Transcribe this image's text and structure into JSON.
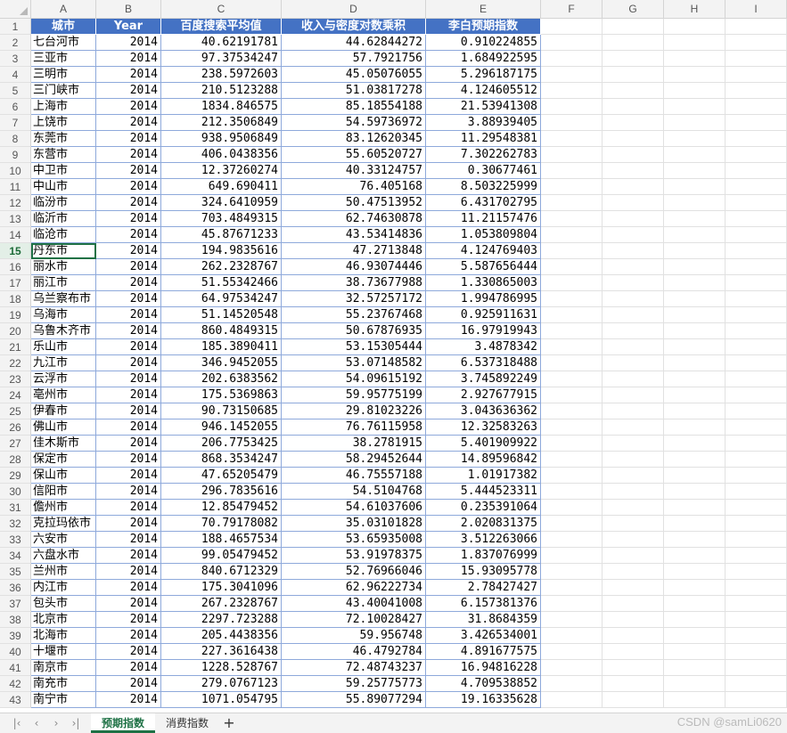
{
  "columns": [
    "A",
    "B",
    "C",
    "D",
    "E",
    "F",
    "G",
    "H",
    "I"
  ],
  "headers": [
    "城市",
    "Year",
    "百度搜索平均值",
    "收入与密度对数乘积",
    "李白预期指数"
  ],
  "rows": [
    [
      "七台河市",
      "2014",
      "40.62191781",
      "44.62844272",
      "0.910224855"
    ],
    [
      "三亚市",
      "2014",
      "97.37534247",
      "57.7921756",
      "1.684922595"
    ],
    [
      "三明市",
      "2014",
      "238.5972603",
      "45.05076055",
      "5.296187175"
    ],
    [
      "三门峡市",
      "2014",
      "210.5123288",
      "51.03817278",
      "4.124605512"
    ],
    [
      "上海市",
      "2014",
      "1834.846575",
      "85.18554188",
      "21.53941308"
    ],
    [
      "上饶市",
      "2014",
      "212.3506849",
      "54.59736972",
      "3.88939405"
    ],
    [
      "东莞市",
      "2014",
      "938.9506849",
      "83.12620345",
      "11.29548381"
    ],
    [
      "东营市",
      "2014",
      "406.0438356",
      "55.60520727",
      "7.302262783"
    ],
    [
      "中卫市",
      "2014",
      "12.37260274",
      "40.33124757",
      "0.30677461"
    ],
    [
      "中山市",
      "2014",
      "649.690411",
      "76.405168",
      "8.503225999"
    ],
    [
      "临汾市",
      "2014",
      "324.6410959",
      "50.47513952",
      "6.431702795"
    ],
    [
      "临沂市",
      "2014",
      "703.4849315",
      "62.74630878",
      "11.21157476"
    ],
    [
      "临沧市",
      "2014",
      "45.87671233",
      "43.53414836",
      "1.053809804"
    ],
    [
      "丹东市",
      "2014",
      "194.9835616",
      "47.2713848",
      "4.124769403"
    ],
    [
      "丽水市",
      "2014",
      "262.2328767",
      "46.93074446",
      "5.587656444"
    ],
    [
      "丽江市",
      "2014",
      "51.55342466",
      "38.73677988",
      "1.330865003"
    ],
    [
      "乌兰察布市",
      "2014",
      "64.97534247",
      "32.57257172",
      "1.994786995"
    ],
    [
      "乌海市",
      "2014",
      "51.14520548",
      "55.23767468",
      "0.925911631"
    ],
    [
      "乌鲁木齐市",
      "2014",
      "860.4849315",
      "50.67876935",
      "16.97919943"
    ],
    [
      "乐山市",
      "2014",
      "185.3890411",
      "53.15305444",
      "3.4878342"
    ],
    [
      "九江市",
      "2014",
      "346.9452055",
      "53.07148582",
      "6.537318488"
    ],
    [
      "云浮市",
      "2014",
      "202.6383562",
      "54.09615192",
      "3.745892249"
    ],
    [
      "亳州市",
      "2014",
      "175.5369863",
      "59.95775199",
      "2.927677915"
    ],
    [
      "伊春市",
      "2014",
      "90.73150685",
      "29.81023226",
      "3.043636362"
    ],
    [
      "佛山市",
      "2014",
      "946.1452055",
      "76.76115958",
      "12.32583263"
    ],
    [
      "佳木斯市",
      "2014",
      "206.7753425",
      "38.2781915",
      "5.401909922"
    ],
    [
      "保定市",
      "2014",
      "868.3534247",
      "58.29452644",
      "14.89596842"
    ],
    [
      "保山市",
      "2014",
      "47.65205479",
      "46.75557188",
      "1.01917382"
    ],
    [
      "信阳市",
      "2014",
      "296.7835616",
      "54.5104768",
      "5.444523311"
    ],
    [
      "儋州市",
      "2014",
      "12.85479452",
      "54.61037606",
      "0.235391064"
    ],
    [
      "克拉玛依市",
      "2014",
      "70.79178082",
      "35.03101828",
      "2.020831375"
    ],
    [
      "六安市",
      "2014",
      "188.4657534",
      "53.65935008",
      "3.512263066"
    ],
    [
      "六盘水市",
      "2014",
      "99.05479452",
      "53.91978375",
      "1.837076999"
    ],
    [
      "兰州市",
      "2014",
      "840.6712329",
      "52.76966046",
      "15.93095778"
    ],
    [
      "内江市",
      "2014",
      "175.3041096",
      "62.96222734",
      "2.78427427"
    ],
    [
      "包头市",
      "2014",
      "267.2328767",
      "43.40041008",
      "6.157381376"
    ],
    [
      "北京市",
      "2014",
      "2297.723288",
      "72.10028427",
      "31.8684359"
    ],
    [
      "北海市",
      "2014",
      "205.4438356",
      "59.956748",
      "3.426534001"
    ],
    [
      "十堰市",
      "2014",
      "227.3616438",
      "46.4792784",
      "4.891677575"
    ],
    [
      "南京市",
      "2014",
      "1228.528767",
      "72.48743237",
      "16.94816228"
    ],
    [
      "南充市",
      "2014",
      "279.0767123",
      "59.25775773",
      "4.709538852"
    ],
    [
      "南宁市",
      "2014",
      "1071.054795",
      "55.89077294",
      "19.16335628"
    ]
  ],
  "active_row": 15,
  "tabs": [
    "预期指数",
    "消费指数"
  ],
  "active_tab": 0,
  "nav_buttons": [
    "first",
    "prev",
    "next",
    "last"
  ],
  "watermark": "CSDN @samLi0620"
}
